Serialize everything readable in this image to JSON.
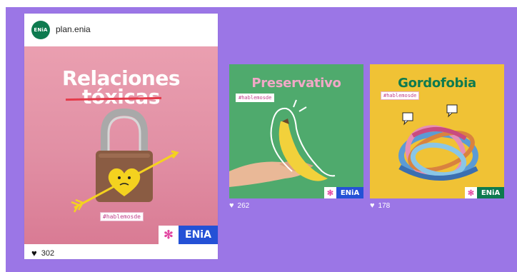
{
  "main_post": {
    "username": "plan.enia",
    "avatar_text": "ENiA",
    "title_line1": "Relaciones",
    "title_line2": "tóxicas",
    "hashtag": "#hablemosde",
    "badge_flower": "✻",
    "badge_logo": "ENiA",
    "likes": "302"
  },
  "posts": [
    {
      "title": "Preservativo",
      "hashtag": "#hablemosde",
      "badge_flower": "✻",
      "badge_logo": "ENiA",
      "likes": "262"
    },
    {
      "title": "Gordofobia",
      "hashtag": "#hablemosde",
      "badge_flower": "✻",
      "badge_logo": "ENiA",
      "likes": "178"
    }
  ],
  "icons": {
    "heart": "heart-icon",
    "flower": "flower-icon"
  },
  "colors": {
    "background": "#9b76e6",
    "brand_green": "#0e7a4f",
    "brand_blue": "#2451d6",
    "pink": "#e245a1",
    "post1_bg": "#4faa6d",
    "post2_bg": "#f0c235",
    "main_bg": "#e18fa4"
  }
}
